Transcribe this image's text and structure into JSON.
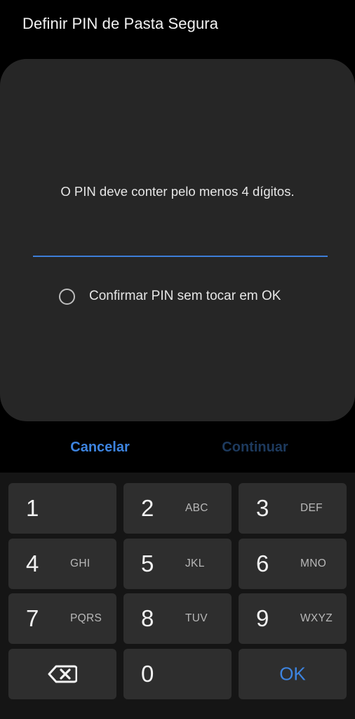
{
  "header": {
    "title": "Definir PIN de Pasta Segura"
  },
  "dialog": {
    "hint": "O PIN deve conter pelo menos 4 dígitos.",
    "pin_value": "",
    "confirm_option_label": "Confirmar PIN sem tocar em OK",
    "confirm_option_checked": false
  },
  "actions": {
    "cancel_label": "Cancelar",
    "continue_label": "Continuar"
  },
  "keypad": {
    "keys": [
      {
        "num": "1",
        "letters": ""
      },
      {
        "num": "2",
        "letters": "ABC"
      },
      {
        "num": "3",
        "letters": "DEF"
      },
      {
        "num": "4",
        "letters": "GHI"
      },
      {
        "num": "5",
        "letters": "JKL"
      },
      {
        "num": "6",
        "letters": "MNO"
      },
      {
        "num": "7",
        "letters": "PQRS"
      },
      {
        "num": "8",
        "letters": "TUV"
      },
      {
        "num": "9",
        "letters": "WXYZ"
      },
      {
        "num": "0",
        "letters": ""
      }
    ],
    "backspace_icon": "backspace-icon",
    "ok_label": "OK"
  },
  "colors": {
    "accent": "#3d84e0",
    "accent_disabled": "#1d3a5e",
    "card_bg": "#262626",
    "key_bg": "#2e2e2e"
  }
}
